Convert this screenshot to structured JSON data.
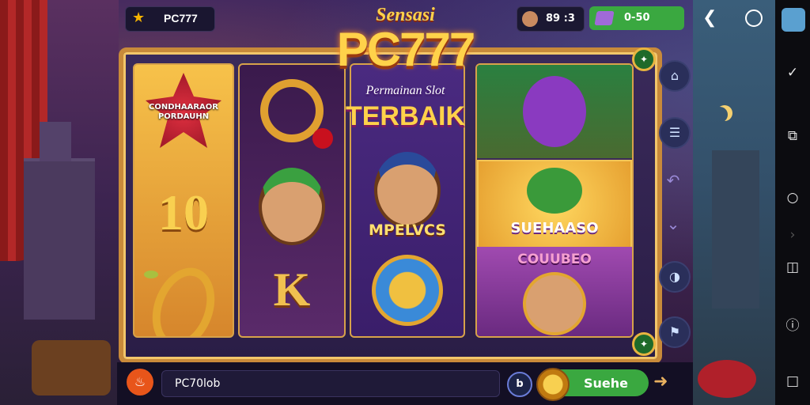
{
  "header": {
    "brand": "PC777",
    "counter": "89 :3",
    "balance": "0-50"
  },
  "logo": {
    "top": "Sensasi",
    "main": "PC777",
    "sub": "Permainan Slot",
    "bottom": "TERBAIK"
  },
  "reels": {
    "r1_seal": "CONDHAARAOR PORDAUHN",
    "r1_number": "10",
    "r2_letter": "K",
    "r3_label": "MPELVCS",
    "r4_mid_label": "SUEHAASO",
    "r4_bottom_label": "COUUBEO"
  },
  "sidebar": {
    "icons": [
      "hat-icon",
      "menu-icon",
      "rotate-icon",
      "down-icon",
      "sound-icon",
      "run-icon"
    ]
  },
  "bottom": {
    "input_value": "PC70lob",
    "badge": "b",
    "spin_label": "Suehe"
  },
  "colors": {
    "accent_gold": "#f2c66a",
    "green": "#3aa840",
    "purple": "#2a1640"
  }
}
